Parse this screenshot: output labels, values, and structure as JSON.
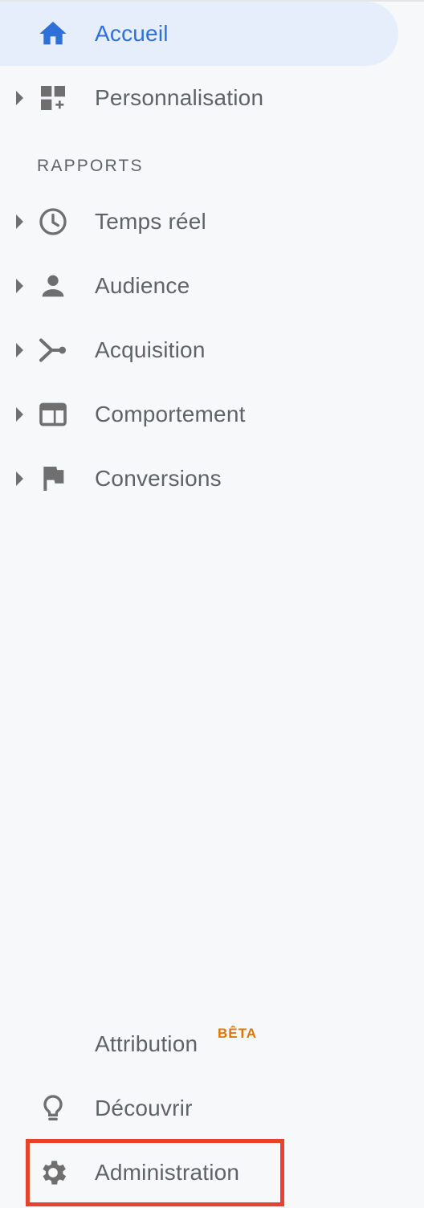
{
  "nav": {
    "home": {
      "label": "Accueil",
      "icon": "home-icon",
      "active": true
    },
    "customization": {
      "label": "Personnalisation",
      "icon": "dashboard-plus-icon"
    },
    "reports_heading": "RAPPORTS",
    "reports": [
      {
        "label": "Temps réel",
        "icon": "clock-icon"
      },
      {
        "label": "Audience",
        "icon": "person-icon"
      },
      {
        "label": "Acquisition",
        "icon": "acquisition-icon"
      },
      {
        "label": "Comportement",
        "icon": "browser-window-icon"
      },
      {
        "label": "Conversions",
        "icon": "flag-icon"
      }
    ],
    "attribution": {
      "label": "Attribution",
      "badge": "BÊTA"
    },
    "discover": {
      "label": "Découvrir",
      "icon": "lightbulb-icon"
    },
    "admin": {
      "label": "Administration",
      "icon": "gear-icon",
      "highlighted": true
    }
  },
  "colors": {
    "active_text": "#2f70d8",
    "active_bg": "#e6eefb",
    "text": "#5f6368",
    "icon": "#6f6f6f",
    "badge": "#e37400",
    "highlight_border": "#e8412c",
    "background": "#f7f8fa"
  }
}
